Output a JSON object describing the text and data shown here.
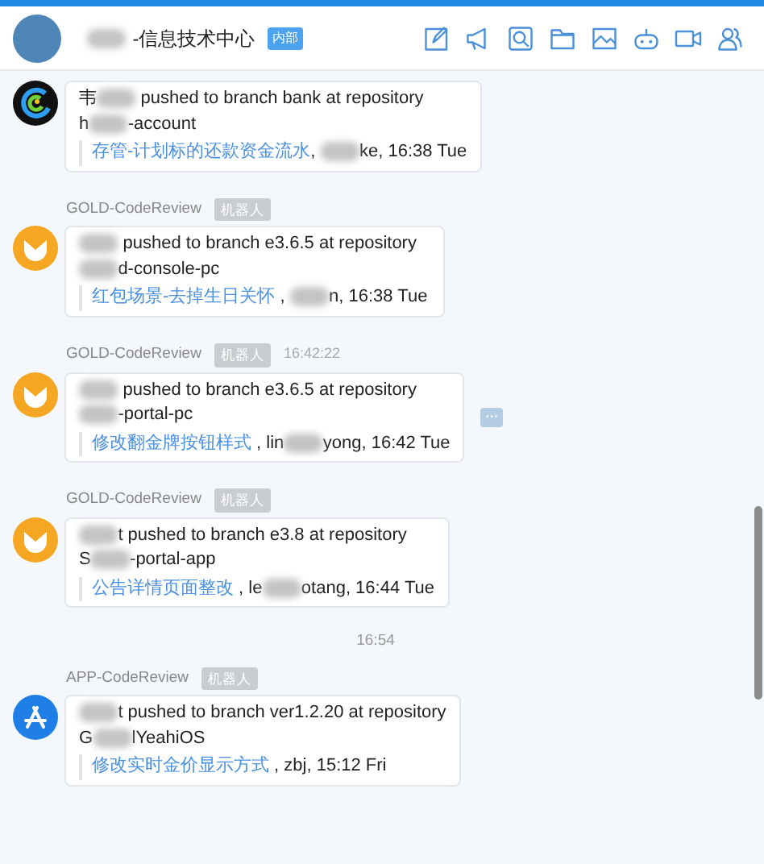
{
  "header": {
    "title": "-信息技术中心",
    "badge": "内部"
  },
  "messages": [
    {
      "avatar": {
        "kind": "swirl"
      },
      "lines": [
        [
          {
            "kind": "text",
            "text": "韦"
          },
          {
            "kind": "blur"
          },
          {
            "kind": "text",
            "text": " pushed to branch bank at repository"
          }
        ],
        [
          {
            "kind": "text",
            "text": "h"
          },
          {
            "kind": "blur"
          },
          {
            "kind": "text",
            "text": "-account"
          }
        ]
      ],
      "commits": [
        [
          {
            "kind": "link",
            "text": "存管-计划标的还款资金流水"
          },
          {
            "kind": "text",
            "text": ", "
          },
          {
            "kind": "blur"
          },
          {
            "kind": "text",
            "text": "ke, 16:38 Tue"
          }
        ]
      ]
    },
    {
      "sender": "GOLD-CodeReview",
      "tag": "机器人",
      "avatar": {
        "kind": "gold"
      },
      "lines": [
        [
          {
            "kind": "blur"
          },
          {
            "kind": "text",
            "text": " pushed to branch e3.6.5 at repository"
          }
        ],
        [
          {
            "kind": "blur"
          },
          {
            "kind": "text",
            "text": "d-console-pc"
          }
        ]
      ],
      "commits": [
        [
          {
            "kind": "link",
            "text": "红包场景-去掉生日关怀"
          },
          {
            "kind": "text",
            "text": " , "
          },
          {
            "kind": "blur"
          },
          {
            "kind": "text",
            "text": "n, 16:38 Tue"
          }
        ]
      ]
    },
    {
      "sender": "GOLD-CodeReview",
      "tag": "机器人",
      "time": "16:42:22",
      "avatar": {
        "kind": "gold"
      },
      "more": "···",
      "lines": [
        [
          {
            "kind": "blur"
          },
          {
            "kind": "text",
            "text": " pushed to branch e3.6.5 at repository"
          }
        ],
        [
          {
            "kind": "blur"
          },
          {
            "kind": "text",
            "text": "-portal-pc"
          }
        ]
      ],
      "commits": [
        [
          {
            "kind": "link",
            "text": "修改翻金牌按钮样式"
          },
          {
            "kind": "text",
            "text": " , lin"
          },
          {
            "kind": "blur"
          },
          {
            "kind": "text",
            "text": "yong, 16:42 Tue"
          }
        ]
      ]
    },
    {
      "sender": "GOLD-CodeReview",
      "tag": "机器人",
      "avatar": {
        "kind": "gold"
      },
      "lines": [
        [
          {
            "kind": "blur"
          },
          {
            "kind": "text",
            "text": "t pushed to branch e3.8 at repository"
          }
        ],
        [
          {
            "kind": "text",
            "text": "S"
          },
          {
            "kind": "blur"
          },
          {
            "kind": "text",
            "text": "-portal-app"
          }
        ]
      ],
      "commits": [
        [
          {
            "kind": "link",
            "text": "公告详情页面整改"
          },
          {
            "kind": "text",
            "text": " , le"
          },
          {
            "kind": "blur"
          },
          {
            "kind": "text",
            "text": "otang, 16:44 Tue"
          }
        ]
      ]
    },
    {
      "divider": "16:54"
    },
    {
      "sender": "APP-CodeReview",
      "tag": "机器人",
      "avatar": {
        "kind": "appstore"
      },
      "lines": [
        [
          {
            "kind": "blur"
          },
          {
            "kind": "text",
            "text": "t pushed to branch ver1.2.20 at repository"
          }
        ],
        [
          {
            "kind": "text",
            "text": "G"
          },
          {
            "kind": "blur"
          },
          {
            "kind": "text",
            "text": "lYeahiOS"
          }
        ]
      ],
      "commits": [
        [
          {
            "kind": "link",
            "text": "修改实时金价显示方式"
          },
          {
            "kind": "text",
            "text": " , zbj, 15:12 Fri"
          }
        ]
      ]
    }
  ]
}
